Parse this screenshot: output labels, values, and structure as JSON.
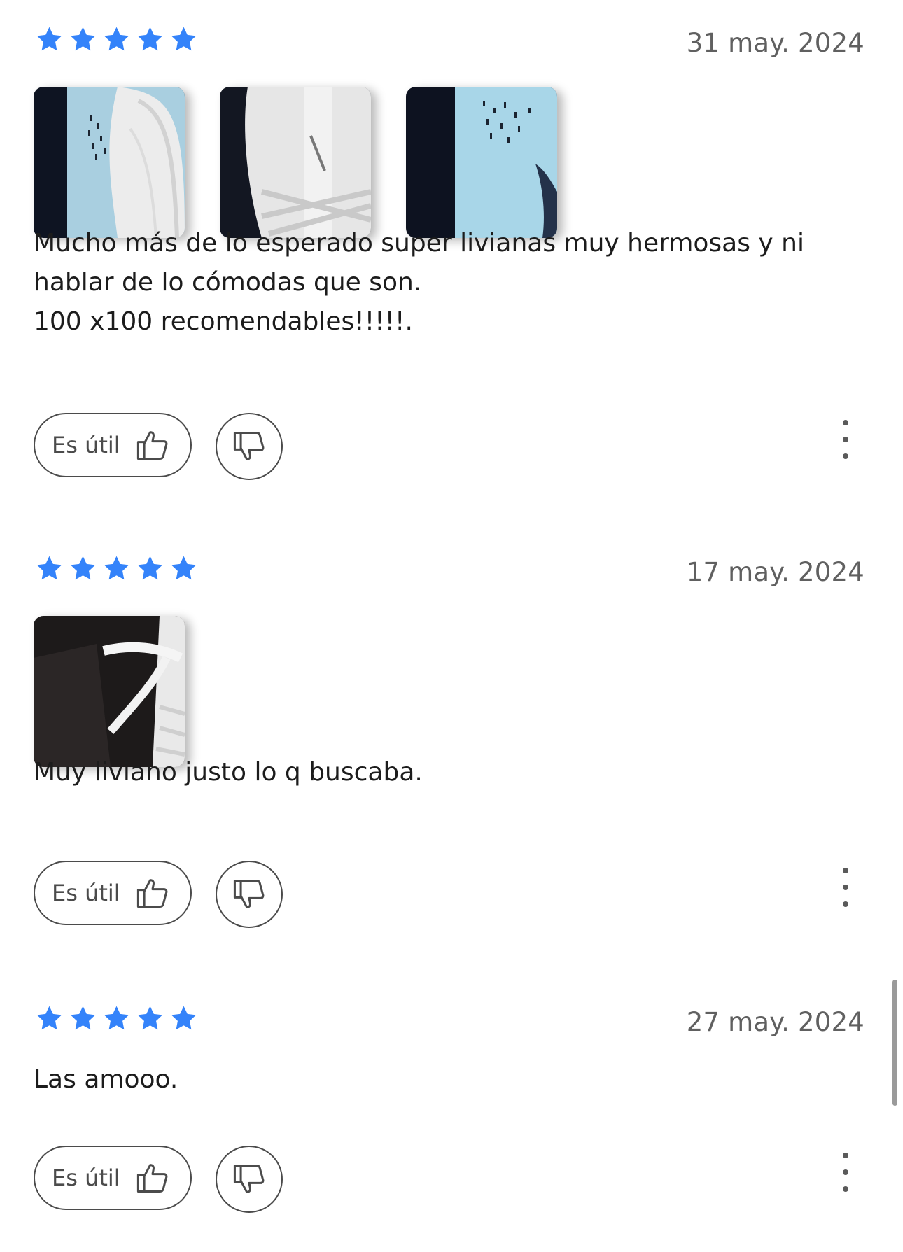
{
  "colors": {
    "star": "#3483fa",
    "text": "#1c1c1c",
    "muted": "#606060",
    "border": "#4b4b4b"
  },
  "reviews": [
    {
      "rating": 5,
      "date": "31 may. 2024",
      "photos": [
        "photo-shoe-box-side",
        "photo-shoe-tongue",
        "photo-shoe-box-lid"
      ],
      "text_lines": [
        "Mucho más de lo esperado super livianas muy hermosas y ni",
        "hablar de lo cómodas que son.",
        "100 x100 recomendables!!!!!."
      ],
      "useful_label": "Es útil"
    },
    {
      "rating": 5,
      "date": "17 may. 2024",
      "photos": [
        "photo-shoe-laces"
      ],
      "text_lines": [
        "Muy liviano justo lo q buscaba."
      ],
      "useful_label": "Es útil"
    },
    {
      "rating": 5,
      "date": "27 may. 2024",
      "photos": [],
      "text_lines": [
        "Las amooo."
      ],
      "useful_label": "Es útil"
    }
  ],
  "icons": {
    "star": "star-icon",
    "thumbs_up": "thumbs-up-icon",
    "thumbs_down": "thumbs-down-icon",
    "more": "more-vertical-icon"
  }
}
